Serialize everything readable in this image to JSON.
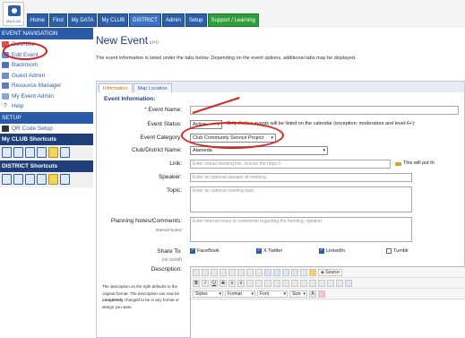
{
  "app": {
    "logo_text": "MyCLUB"
  },
  "nav": {
    "tabs": [
      "Home",
      "Find",
      "My DATA",
      "My CLUB",
      "DISTRICT",
      "Admin",
      "Setup",
      "Support / Learning"
    ],
    "active": "DISTRICT"
  },
  "sidebar": {
    "event_nav_title": "EVENT NAVIGATION",
    "items": [
      {
        "label": "Calendar",
        "icon": "calendar-icon"
      },
      {
        "label": "Edit Event",
        "icon": "edit-icon"
      },
      {
        "label": "Backroom",
        "icon": "people-icon"
      },
      {
        "label": "Guest Admin",
        "icon": "person-icon"
      },
      {
        "label": "Resource Manager",
        "icon": "list-icon"
      },
      {
        "label": "My Event Admin",
        "icon": "document-icon"
      },
      {
        "label": "Help",
        "icon": "help-icon"
      }
    ],
    "setup_title": "SETUP",
    "setup_items": [
      {
        "label": "QR Code Setup",
        "icon": "qr-icon"
      }
    ],
    "club_shortcuts_title": "My CLUB Shortcuts",
    "district_shortcuts_title": "DISTRICT Shortcuts"
  },
  "page": {
    "title": "New Event",
    "subtitle": "id=0",
    "intro": "The event information is listed under the tabs below. Depending on the event options, additional tabs may be displayed."
  },
  "form": {
    "tabs": [
      "Information",
      "Map Location"
    ],
    "active_tab": "Information",
    "section_title": "Event Information:",
    "event_name_label": "Event Name:",
    "event_status_label": "Event Status:",
    "event_status_value": "Active",
    "event_status_note_prefix": "Only",
    "event_status_note_bold": "Active",
    "event_status_note_suffix": "events will be listed on the calendar (exception: moderators and level-6+):",
    "event_category_label": "Event Category:",
    "event_category_value": "Club Community Service Project",
    "club_district_label": "Club/District Name:",
    "club_district_value": "Alameda",
    "link_label": "Link:",
    "link_placeholder": "Enter virtual meeting link, include the https://",
    "link_note": "This will put th",
    "speaker_label": "Speaker:",
    "speaker_placeholder": "Enter an optional speaker at meeting",
    "topic_label": "Topic:",
    "topic_placeholder": "Enter an optional meeting topic",
    "notes_label": "Planning Notes/Comments:",
    "notes_sublabel": "Internal Notes!",
    "notes_placeholder": "Enter internal notes or comments regarding the meeting, speaker",
    "share_label": "Share To:",
    "share_sublabel": "(All On/Off)",
    "share_options": [
      {
        "label": "FaceBook",
        "checked": true
      },
      {
        "label": "X Twitter",
        "checked": true
      },
      {
        "label": "LinkedIn",
        "checked": true
      },
      {
        "label": "Tumblr",
        "checked": false
      }
    ],
    "description_label": "Description:",
    "description_help_1": "The description on the right defaults to the original format. The description can now be",
    "description_help_bold": "completely",
    "description_help_2": "changed to be in any format or design you want.",
    "editor": {
      "source_label": "Source",
      "styles_label": "Styles",
      "format_label": "Format",
      "font_label": "Font",
      "size_label": "Size"
    }
  }
}
